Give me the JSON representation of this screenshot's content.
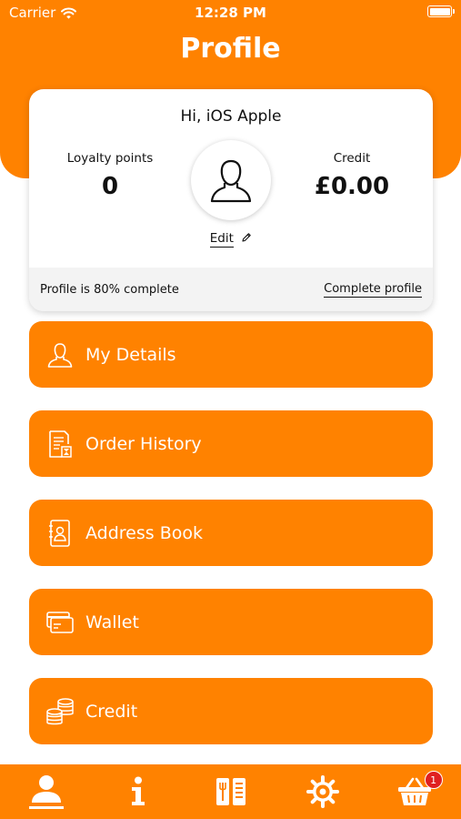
{
  "status_bar": {
    "carrier": "Carrier",
    "time": "12:28 PM"
  },
  "header": {
    "title": "Profile"
  },
  "profile": {
    "greeting": "Hi, iOS Apple",
    "loyalty_label": "Loyalty points",
    "loyalty_value": "0",
    "credit_label": "Credit",
    "credit_value": "£0.00",
    "edit_label": "Edit",
    "completion_text": "Profile is 80% complete",
    "completion_fraction": 0.8,
    "complete_link": "Complete profile"
  },
  "menu": {
    "items": [
      {
        "label": "My Details",
        "icon": "user-outline-icon"
      },
      {
        "label": "Order History",
        "icon": "receipt-clock-icon"
      },
      {
        "label": "Address Book",
        "icon": "address-book-icon"
      },
      {
        "label": "Wallet",
        "icon": "credit-card-icon"
      },
      {
        "label": "Credit",
        "icon": "coins-stack-icon"
      }
    ]
  },
  "tab_bar": {
    "tabs": [
      {
        "name": "profile",
        "icon": "user-icon"
      },
      {
        "name": "info",
        "icon": "info-icon"
      },
      {
        "name": "menu",
        "icon": "menu-book-icon"
      },
      {
        "name": "settings",
        "icon": "gear-icon"
      },
      {
        "name": "basket",
        "icon": "basket-icon"
      }
    ],
    "basket_badge": "1"
  },
  "colors": {
    "brand": "#ff8200",
    "badge": "#e02020"
  }
}
